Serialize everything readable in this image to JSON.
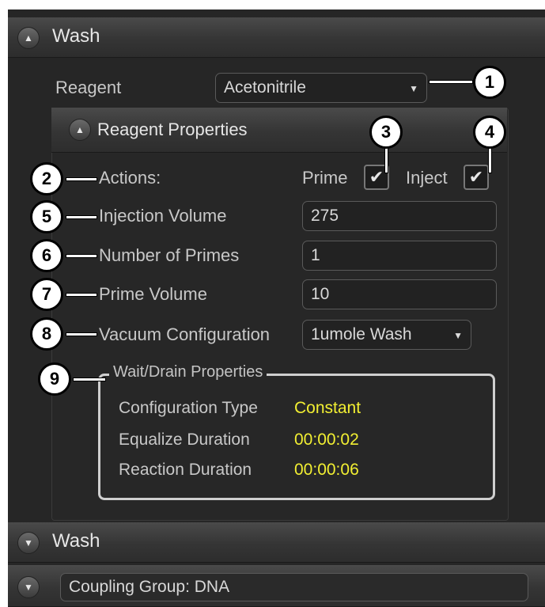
{
  "wash_section": {
    "title": "Wash"
  },
  "reagent": {
    "label": "Reagent",
    "value": "Acetonitrile"
  },
  "reagent_properties": {
    "title": "Reagent Properties",
    "actions_label": "Actions:",
    "prime_label": "Prime",
    "inject_label": "Inject",
    "injection_volume_label": "Injection Volume",
    "injection_volume_value": "275",
    "number_of_primes_label": "Number of Primes",
    "number_of_primes_value": "1",
    "prime_volume_label": "Prime Volume",
    "prime_volume_value": "10",
    "vacuum_configuration_label": "Vacuum Configuration",
    "vacuum_configuration_value": "1umole Wash"
  },
  "wait_drain": {
    "title": "Wait/Drain Properties",
    "configuration_type_label": "Configuration Type",
    "configuration_type_value": "Constant",
    "equalize_duration_label": "Equalize Duration",
    "equalize_duration_value": "00:00:02",
    "reaction_duration_label": "Reaction Duration",
    "reaction_duration_value": "00:00:06"
  },
  "wash_section_2": {
    "title": "Wash"
  },
  "coupling_group": {
    "value": "Coupling Group: DNA"
  },
  "callouts": [
    "1",
    "2",
    "3",
    "4",
    "5",
    "6",
    "7",
    "8",
    "9"
  ],
  "colors": {
    "accent_value": "#f2ef32",
    "panel_bg": "#262626"
  }
}
